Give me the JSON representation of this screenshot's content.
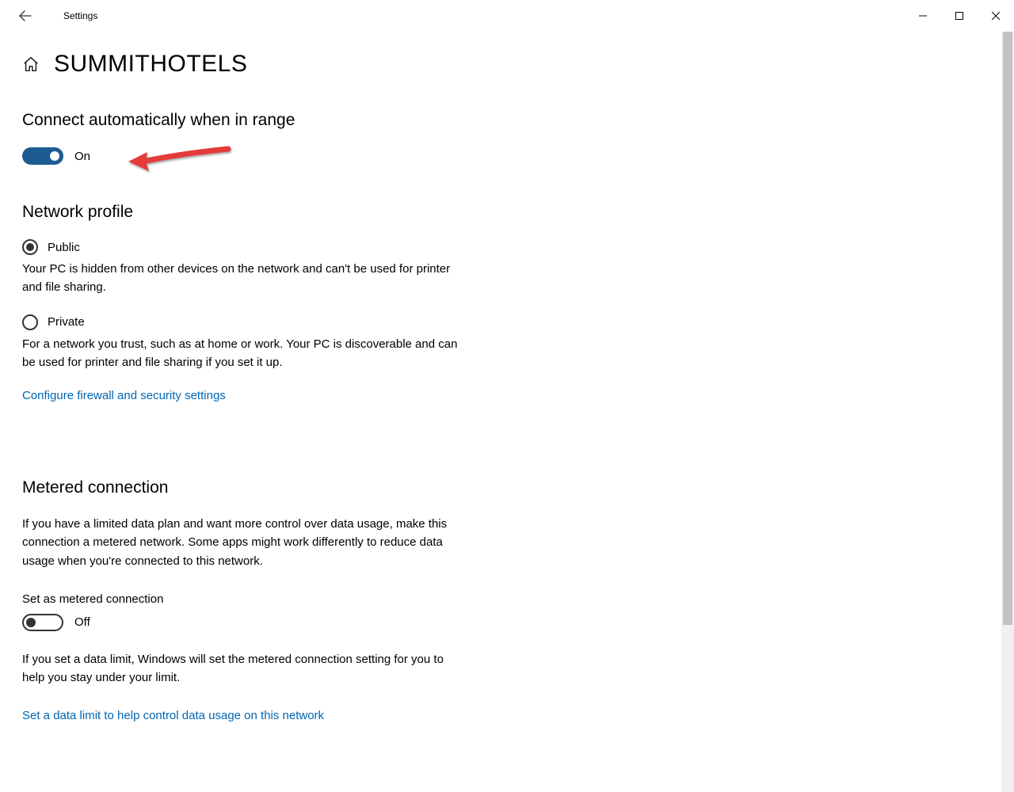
{
  "window": {
    "title": "Settings"
  },
  "page": {
    "title": "SUMMITHOTELS"
  },
  "autoConnect": {
    "heading": "Connect automatically when in range",
    "state_label": "On",
    "state_on": true
  },
  "networkProfile": {
    "heading": "Network profile",
    "options": [
      {
        "label": "Public",
        "selected": true,
        "description": "Your PC is hidden from other devices on the network and can't be used for printer and file sharing."
      },
      {
        "label": "Private",
        "selected": false,
        "description": "For a network you trust, such as at home or work. Your PC is discoverable and can be used for printer and file sharing if you set it up."
      }
    ],
    "firewall_link": "Configure firewall and security settings"
  },
  "metered": {
    "heading": "Metered connection",
    "description": "If you have a limited data plan and want more control over data usage, make this connection a metered network. Some apps might work differently to reduce data usage when you're connected to this network.",
    "toggle_label": "Set as metered connection",
    "state_label": "Off",
    "state_on": false,
    "note": "If you set a data limit, Windows will set the metered connection setting for you to help you stay under your limit.",
    "data_limit_link": "Set a data limit to help control data usage on this network"
  },
  "annotation": {
    "arrow_color": "#e43b3b"
  }
}
